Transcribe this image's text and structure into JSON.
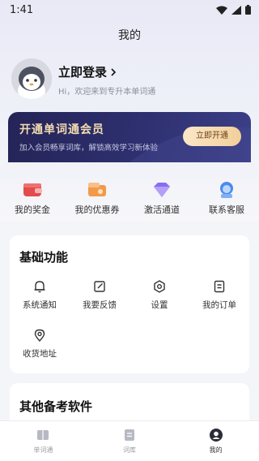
{
  "status_bar": {
    "time": "1:41"
  },
  "page": {
    "title": "我的"
  },
  "profile": {
    "login_label": "立即登录",
    "greeting": "Hi，欢迎来到专升本单词通"
  },
  "vip": {
    "title": "开通单词通会员",
    "subtitle": "加入会员畅享词库，解锁高效学习新体验",
    "button": "立即开通"
  },
  "quick_actions": [
    {
      "label": "我的奖金",
      "icon": "wallet-icon"
    },
    {
      "label": "我的优惠券",
      "icon": "coupon-icon"
    },
    {
      "label": "激活通道",
      "icon": "diamond-icon"
    },
    {
      "label": "联系客服",
      "icon": "customer-service-icon"
    }
  ],
  "basic_functions": {
    "title": "基础功能",
    "items": [
      {
        "label": "系统通知",
        "icon": "bell-icon"
      },
      {
        "label": "我要反馈",
        "icon": "edit-icon"
      },
      {
        "label": "设置",
        "icon": "settings-icon"
      },
      {
        "label": "我的订单",
        "icon": "order-icon"
      },
      {
        "label": "收货地址",
        "icon": "location-icon"
      }
    ]
  },
  "other_software": {
    "title": "其他备考软件"
  },
  "tab_bar": {
    "tabs": [
      {
        "label": "单词通",
        "icon": "book-icon",
        "active": false
      },
      {
        "label": "词库",
        "icon": "list-icon",
        "active": false
      },
      {
        "label": "我的",
        "icon": "user-icon",
        "active": true
      }
    ]
  },
  "colors": {
    "vip_bg": "#2e3070",
    "vip_gold": "#f4dcb0",
    "accent_red": "#e24c4c",
    "accent_orange": "#f29a4a",
    "accent_purple": "#8a6cf0",
    "accent_blue": "#4a8af0"
  }
}
